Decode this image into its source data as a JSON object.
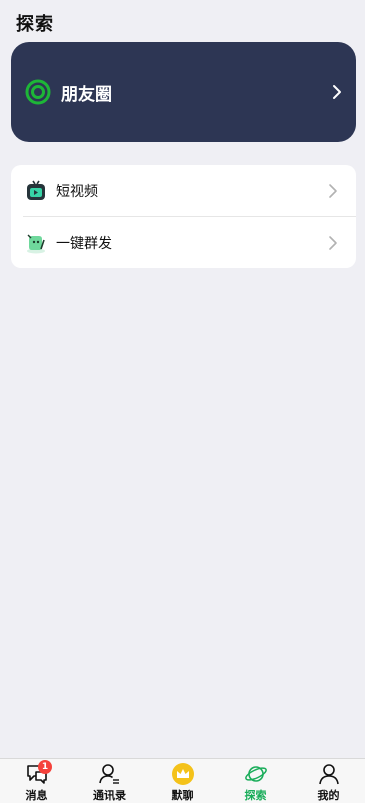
{
  "header": {
    "title": "探索"
  },
  "moments": {
    "label": "朋友圈"
  },
  "list": {
    "items": [
      {
        "label": "短视频",
        "icon": "short-video-icon"
      },
      {
        "label": "一键群发",
        "icon": "broadcast-icon"
      }
    ]
  },
  "tabbar": {
    "tabs": [
      {
        "label": "消息",
        "icon": "chat-bubble-icon",
        "badge": "1"
      },
      {
        "label": "通讯录",
        "icon": "contacts-icon"
      },
      {
        "label": "默聊",
        "icon": "crown-icon"
      },
      {
        "label": "探索",
        "icon": "planet-icon",
        "active": true
      },
      {
        "label": "我的",
        "icon": "person-icon"
      }
    ]
  },
  "colors": {
    "accent": "#1aad5a",
    "card": "#2d3654",
    "badge": "#f5423b",
    "crown": "#f4c21a"
  }
}
